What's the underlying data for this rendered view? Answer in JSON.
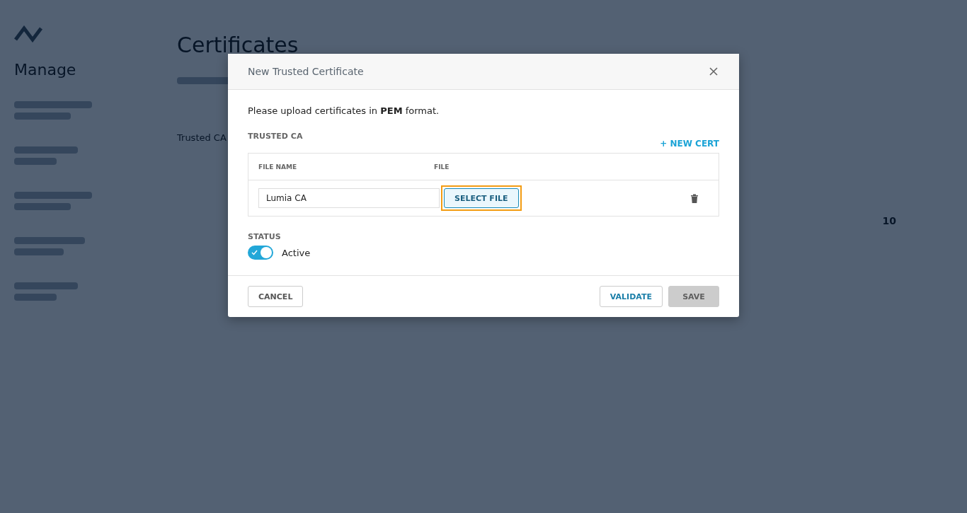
{
  "background": {
    "title": "Certificates",
    "sidebar_heading": "Manage",
    "section": "Trusted CA",
    "page_size": "10"
  },
  "dialog": {
    "title": "New Trusted Certificate",
    "intro": "Please upload certificates in **PEM** format.",
    "section_label": "TRUSTED CA",
    "new_cert_link": "+ NEW CERT",
    "columns": [
      "FILE NAME",
      "FILE"
    ],
    "rows": [
      {
        "file_name": "Lumia CA",
        "button": "SELECT FILE",
        "highlighted": true
      }
    ],
    "status_label": "STATUS",
    "status": {
      "label": "Active",
      "on": true
    },
    "buttons": [
      {
        "label": "CANCEL",
        "kind": "secondary",
        "disabled": false
      },
      {
        "label": "VALIDATE",
        "kind": "outline",
        "disabled": false
      },
      {
        "label": "SAVE",
        "kind": "primary",
        "disabled": true
      }
    ]
  }
}
